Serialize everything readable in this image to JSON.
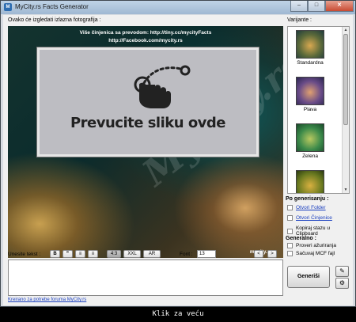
{
  "window": {
    "title": "MyCity.rs Facts Generator",
    "minimize": "–",
    "maximize": "□",
    "close": "✕"
  },
  "preview": {
    "label": "Ovako će izgledati izlazna fotografija :",
    "line1": "Više činjenica sa prevodom: http://tiny.cc/mycityFacts",
    "line2": "http://Facebook.com/mycity.rs",
    "drop_text": "Prevucite sliku ovde",
    "corner_brand": "mycity.rs",
    "watermark": "MyCity.rs"
  },
  "variants": {
    "label": "Varijante :",
    "items": [
      {
        "name": "Standardna"
      },
      {
        "name": "Plava"
      },
      {
        "name": "Zelena"
      },
      {
        "name": ""
      }
    ]
  },
  "after_generate": {
    "heading": "Po generisanju :",
    "open_folder": "Otvori Folder",
    "open_fact": "Otvori Činjenice",
    "copy_path": "Kopiraj stazu u Clipboard"
  },
  "general": {
    "heading": "Generalno :",
    "check_updates": "Proveri ažuriranja",
    "save_mcf": "Sačuvaj MCF fajl"
  },
  "toolbar": {
    "label": "Unesite tekst :",
    "bold": "B",
    "quote": "❞",
    "align_left": "≡",
    "align_center": "≡",
    "ratio": "4:3",
    "xxl": "XXL",
    "ar": "AR",
    "font_label": "Font :",
    "font_value": "13",
    "prev": "<",
    "next": ">"
  },
  "text_input": {
    "value": ""
  },
  "generate_button": "Generiši",
  "footer_link": "Kreirano za potrebe foruma MyCity.rs",
  "caption": "Klik za veću",
  "colors": {
    "accent": "#1a3fbf",
    "titlebar": "#9fb8d2"
  }
}
